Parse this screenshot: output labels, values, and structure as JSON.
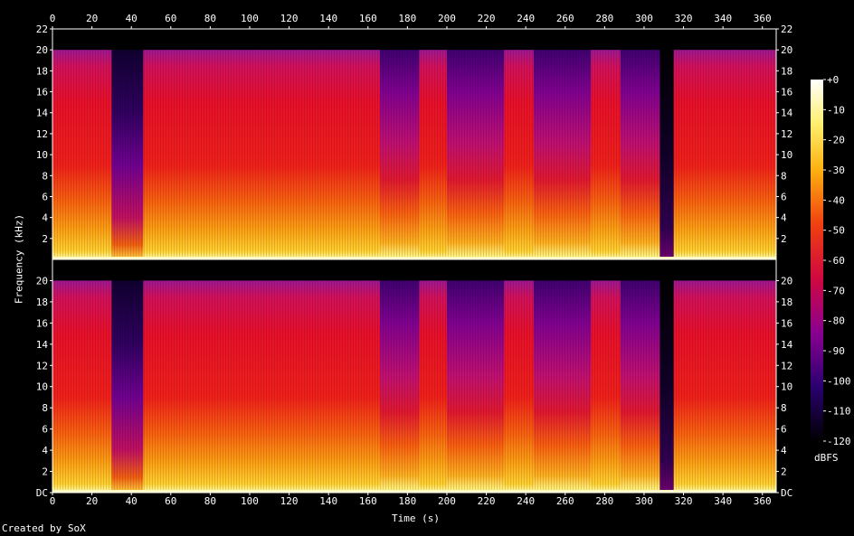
{
  "chart_data": {
    "type": "heatmap",
    "title": "",
    "xlabel": "Time (s)",
    "ylabel": "Frequency (kHz)",
    "colorbar_label": "dBFS",
    "footer": "Created by SoX",
    "xlim": [
      0,
      367
    ],
    "ylim": [
      0,
      22
    ],
    "x_ticks": [
      "0",
      "20",
      "40",
      "60",
      "80",
      "100",
      "120",
      "140",
      "160",
      "180",
      "200",
      "220",
      "240",
      "260",
      "280",
      "300",
      "320",
      "340",
      "360"
    ],
    "x_tick_values": [
      0,
      20,
      40,
      60,
      80,
      100,
      120,
      140,
      160,
      180,
      200,
      220,
      240,
      260,
      280,
      300,
      320,
      340,
      360
    ],
    "y_ticks_top": [
      "2",
      "4",
      "6",
      "8",
      "10",
      "12",
      "14",
      "16",
      "18",
      "20",
      "22"
    ],
    "y_ticks_bottom": [
      "DC",
      "2",
      "4",
      "6",
      "8",
      "10",
      "12",
      "14",
      "16",
      "18",
      "20"
    ],
    "y_tick_values_top": [
      2,
      4,
      6,
      8,
      10,
      12,
      14,
      16,
      18,
      20,
      22
    ],
    "y_tick_values_bottom": [
      0,
      2,
      4,
      6,
      8,
      10,
      12,
      14,
      16,
      18,
      20
    ],
    "colorbar_ticks": [
      "+0",
      "-10",
      "-20",
      "-30",
      "-40",
      "-50",
      "-60",
      "-70",
      "-80",
      "-90",
      "-100",
      "-110",
      "-120"
    ],
    "colorbar_values": [
      0,
      -10,
      -20,
      -30,
      -40,
      -50,
      -60,
      -70,
      -80,
      -90,
      -100,
      -110,
      -120
    ],
    "channels": 2,
    "segments": [
      {
        "start": 0,
        "end": 30,
        "cutoff_khz": 20,
        "level": "loud"
      },
      {
        "start": 30,
        "end": 46,
        "cutoff_khz": 20,
        "level": "quiet"
      },
      {
        "start": 46,
        "end": 76,
        "cutoff_khz": 20,
        "level": "loud"
      },
      {
        "start": 76,
        "end": 105,
        "cutoff_khz": 20,
        "level": "loud"
      },
      {
        "start": 105,
        "end": 135,
        "cutoff_khz": 20,
        "level": "loud"
      },
      {
        "start": 135,
        "end": 166,
        "cutoff_khz": 20,
        "level": "loud"
      },
      {
        "start": 166,
        "end": 186,
        "cutoff_khz": 20,
        "level": "medium"
      },
      {
        "start": 186,
        "end": 200,
        "cutoff_khz": 20,
        "level": "loud"
      },
      {
        "start": 200,
        "end": 229,
        "cutoff_khz": 20,
        "level": "medium"
      },
      {
        "start": 229,
        "end": 244,
        "cutoff_khz": 20,
        "level": "loud"
      },
      {
        "start": 244,
        "end": 273,
        "cutoff_khz": 20,
        "level": "medium"
      },
      {
        "start": 273,
        "end": 288,
        "cutoff_khz": 20,
        "level": "loud"
      },
      {
        "start": 288,
        "end": 308,
        "cutoff_khz": 20,
        "level": "medium"
      },
      {
        "start": 308,
        "end": 315,
        "cutoff_khz": 20,
        "level": "silent"
      },
      {
        "start": 315,
        "end": 367,
        "cutoff_khz": 20,
        "level": "loud"
      }
    ]
  }
}
